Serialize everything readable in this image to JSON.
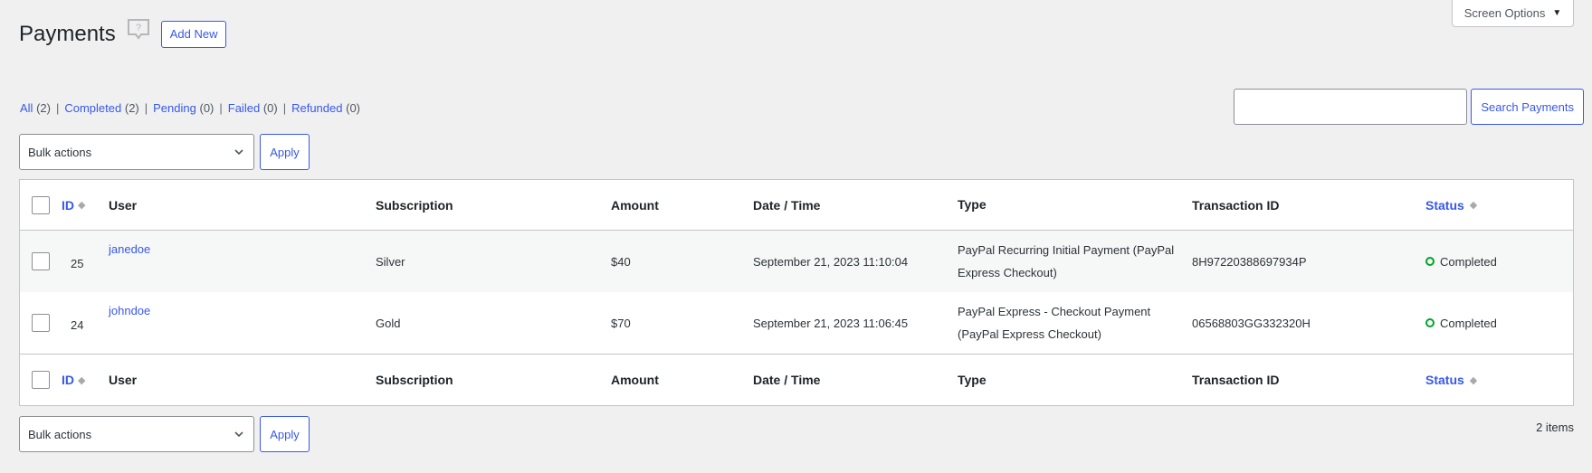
{
  "screen_options": {
    "label": "Screen Options",
    "icon": "caret-down-icon"
  },
  "header": {
    "title": "Payments",
    "help_icon": "help-bubble-icon",
    "add_new_label": "Add New"
  },
  "filters": [
    {
      "label": "All",
      "count": "(2)",
      "current": true
    },
    {
      "label": "Completed",
      "count": "(2)"
    },
    {
      "label": "Pending",
      "count": "(0)"
    },
    {
      "label": "Failed",
      "count": "(0)"
    },
    {
      "label": "Refunded",
      "count": "(0)"
    }
  ],
  "search": {
    "value": "",
    "placeholder": "",
    "button_label": "Search Payments"
  },
  "bulk_actions": {
    "selected": "Bulk actions",
    "apply_label": "Apply"
  },
  "columns": {
    "id": "ID",
    "user": "User",
    "subscription": "Subscription",
    "amount": "Amount",
    "date": "Date / Time",
    "type": "Type",
    "transaction": "Transaction ID",
    "status": "Status"
  },
  "rows": [
    {
      "id": "25",
      "user": "janedoe",
      "subscription": "Silver",
      "amount": "$40",
      "date": "September 21, 2023 11:10:04",
      "type": "PayPal Recurring Initial Payment (PayPal Express Checkout)",
      "transaction": "8H97220388697934P",
      "status": "Completed"
    },
    {
      "id": "24",
      "user": "johndoe",
      "subscription": "Gold",
      "amount": "$70",
      "date": "September 21, 2023 11:06:45",
      "type": "PayPal Express - Checkout Payment (PayPal Express Checkout)",
      "transaction": "06568803GG332320H",
      "status": "Completed"
    }
  ],
  "items_count": "2 items",
  "colors": {
    "accent": "#3858e9",
    "status_completed": "#00a32a"
  }
}
